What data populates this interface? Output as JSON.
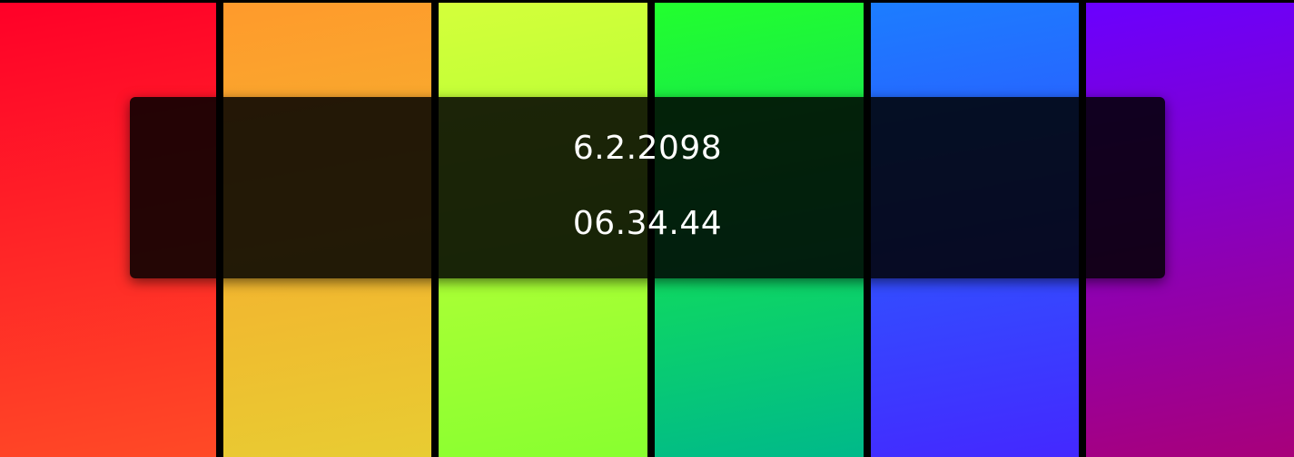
{
  "clock": {
    "date": "6.2.2098",
    "time": "06.34.44"
  },
  "stripes": [
    {
      "name": "red",
      "color_top": "#ff0028",
      "color_bottom": "#ff4a26"
    },
    {
      "name": "orange",
      "color_top": "#ff9a2c",
      "color_bottom": "#e8cc32"
    },
    {
      "name": "yellow-green",
      "color_top": "#d4ff3a",
      "color_bottom": "#88ff30"
    },
    {
      "name": "green",
      "color_top": "#22ff2e",
      "color_bottom": "#00b98a"
    },
    {
      "name": "blue",
      "color_top": "#1c7dff",
      "color_bottom": "#4428ff"
    },
    {
      "name": "purple",
      "color_top": "#6a00ff",
      "color_bottom": "#a8007a"
    }
  ],
  "theme": {
    "background": "#000000",
    "overlay": "rgba(0,0,0,0.86)",
    "text": "#ffffff"
  }
}
